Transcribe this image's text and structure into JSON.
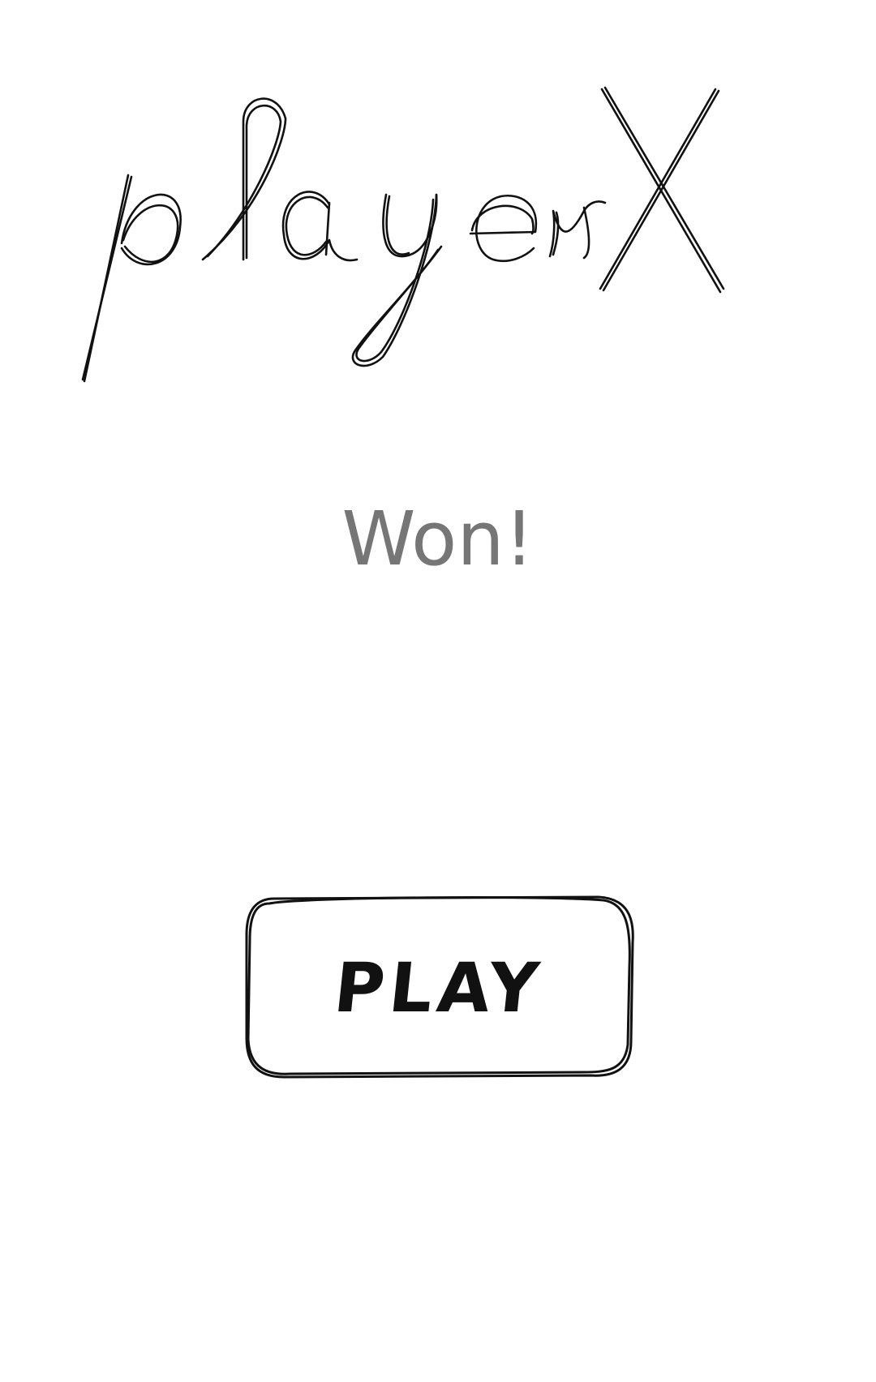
{
  "winner": {
    "player_label": "player",
    "player_symbol": "X"
  },
  "result": {
    "text": "Won!"
  },
  "play_button": {
    "label": "PLAY"
  },
  "colors": {
    "background": "#ffffff",
    "ink": "#111111",
    "result_text": "#767676"
  }
}
